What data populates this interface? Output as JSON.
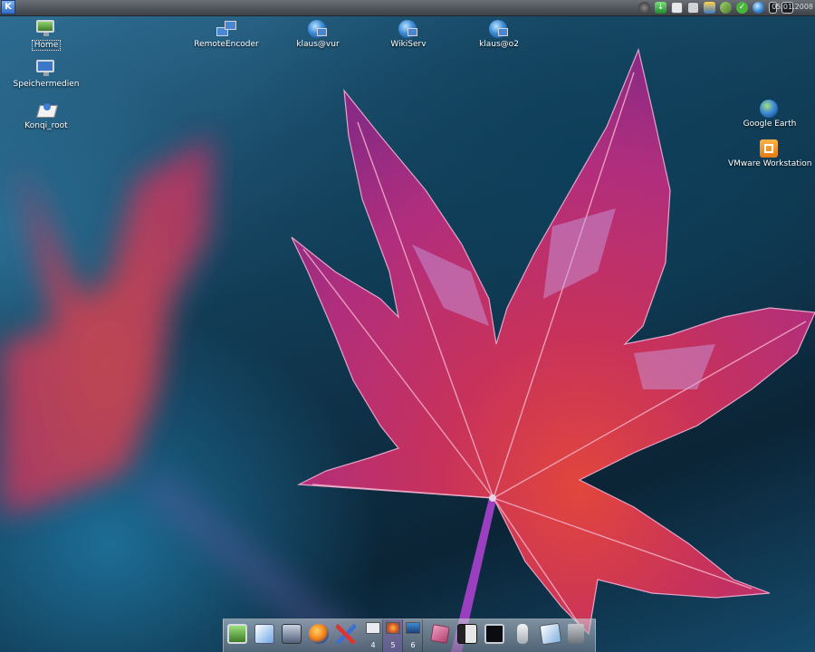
{
  "panel": {
    "kmenu_glyph": "K",
    "clock": "05.01.2008",
    "tray_icons": [
      "speaker-icon",
      "download-icon",
      "clipboard-icon",
      "printer-icon",
      "network-monitor-icon",
      "connection-icon",
      "update-ok-icon",
      "network-globe-icon",
      "keyboard-layout-icon",
      "desktop-switch-icon"
    ]
  },
  "desktop_icons": [
    {
      "label": "Home",
      "icon": "home-monitor-icon"
    },
    {
      "label": "Speichermedien",
      "icon": "computer-icon"
    },
    {
      "label": "Konqi_root",
      "icon": "konqueror-icon"
    },
    {
      "label": "RemoteEncoder",
      "icon": "network-computers-icon"
    },
    {
      "label": "klaus@vur",
      "icon": "remote-globe-icon"
    },
    {
      "label": "WikiServ",
      "icon": "remote-globe-icon"
    },
    {
      "label": "klaus@o2",
      "icon": "remote-globe-icon"
    },
    {
      "label": "Google Earth",
      "icon": "google-earth-icon"
    },
    {
      "label": "VMware Workstation",
      "icon": "vmware-icon"
    }
  ],
  "dock": {
    "launchers": [
      "desktop-icon",
      "kwrite-icon",
      "mail-icon",
      "firefox-icon",
      "tools-icon",
      "cube-icon",
      "panel-icon",
      "terminal-icon",
      "usb-icon",
      "image-viewer-icon",
      "trash-icon"
    ],
    "pager": [
      {
        "number": "4",
        "active": false
      },
      {
        "number": "5",
        "active": true
      },
      {
        "number": "6",
        "active": false
      }
    ]
  }
}
